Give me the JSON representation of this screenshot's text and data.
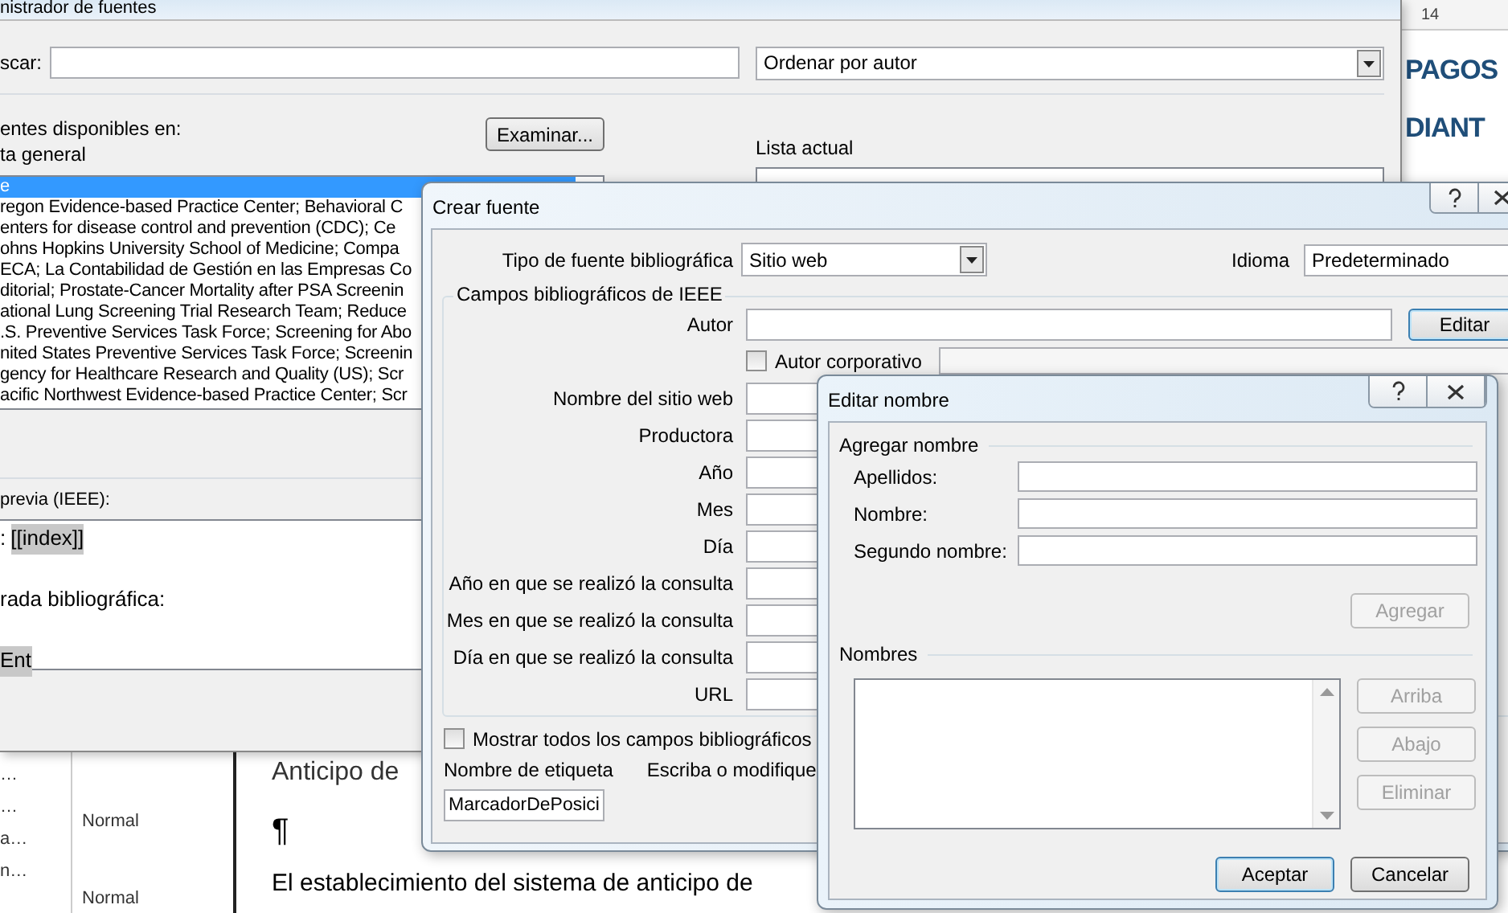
{
  "document": {
    "ruler_number": "14",
    "heading_lines": [
      "PAGOS",
      "DIANT"
    ],
    "style_items": [
      "…",
      "…",
      "a…",
      "n…"
    ],
    "style_names": [
      "Normal",
      "Normal"
    ],
    "body": [
      {
        "kind": "heading",
        "text": "Anticipo de"
      },
      {
        "kind": "mark",
        "text": "¶"
      },
      {
        "kind": "paragraph",
        "text": "El establecimiento del sistema de anticipo de"
      }
    ]
  },
  "source_manager": {
    "title": "nistrador de fuentes",
    "search_label": "scar:",
    "sort": "Ordenar por autor",
    "available_label": "entes disponibles en:",
    "list_label": "ta general",
    "browse_button": "Examinar...",
    "current_label": "Lista actual",
    "sources": [
      {
        "text": "e",
        "selected": true
      },
      {
        "text": "regon Evidence-based Practice Center; Behavioral C",
        "selected": false
      },
      {
        "text": "enters for disease control and prevention (CDC); Ce",
        "selected": false
      },
      {
        "text": "ohns Hopkins University School of Medicine; Compa",
        "selected": false
      },
      {
        "text": "ECA; La Contabilidad de Gestión en las Empresas Co",
        "selected": false
      },
      {
        "text": "ditorial; Prostate-Cancer Mortality after PSA Screenin",
        "selected": false
      },
      {
        "text": "ational Lung Screening Trial Research Team; Reduce",
        "selected": false
      },
      {
        "text": ".S. Preventive Services Task Force; Screening for Abo",
        "selected": false
      },
      {
        "text": "nited States Preventive Services Task Force; Screenin",
        "selected": false
      },
      {
        "text": "gency for Healthcare Research and Quality (US); Scr",
        "selected": false
      },
      {
        "text": "acific Northwest Evidence-based Practice Center; Scr",
        "selected": false
      }
    ],
    "preview_label": "previa (IEEE):",
    "preview_lines": [
      {
        "text": ":",
        "field": "[[index]]"
      },
      {
        "text": "rada bibliográfica:"
      },
      {
        "field": "Ent"
      }
    ]
  },
  "create_source": {
    "title": "Crear fuente",
    "type_label": "Tipo de fuente bibliográfica",
    "type_value": "Sitio web",
    "language_label": "Idioma",
    "language_value": "Predeterminado",
    "group_label": "Campos bibliográficos de IEEE",
    "author": {
      "label": "Autor",
      "button": "Editar",
      "corporate": {
        "label": "Autor corporativo",
        "checked": false
      }
    },
    "fields": [
      "Nombre del sitio web",
      "Productora",
      "Año",
      "Mes",
      "Día",
      "Año en que se realizó la consulta",
      "Mes en que se realizó la consulta",
      "Día en que se realizó la consulta",
      "URL"
    ],
    "show_all": {
      "label": "Mostrar todos los campos bibliográficos",
      "checked": false
    },
    "tag_label": "Nombre de etiqueta",
    "tag_hint": "Escriba o modifique",
    "tag_value": "MarcadorDePosici"
  },
  "edit_name": {
    "title": "Editar nombre",
    "add_group": "Agregar nombre",
    "name_fields": [
      "Apellidos:",
      "Nombre:",
      "Segundo nombre:"
    ],
    "add_button": {
      "label": "Agregar",
      "disabled": true
    },
    "names_label": "Nombres",
    "list_buttons": [
      {
        "label": "Arriba",
        "disabled": true
      },
      {
        "label": "Abajo",
        "disabled": true
      },
      {
        "label": "Eliminar",
        "disabled": true
      }
    ],
    "footer_buttons": [
      {
        "label": "Aceptar",
        "default": true
      },
      {
        "label": "Cancelar",
        "default": false
      }
    ]
  }
}
